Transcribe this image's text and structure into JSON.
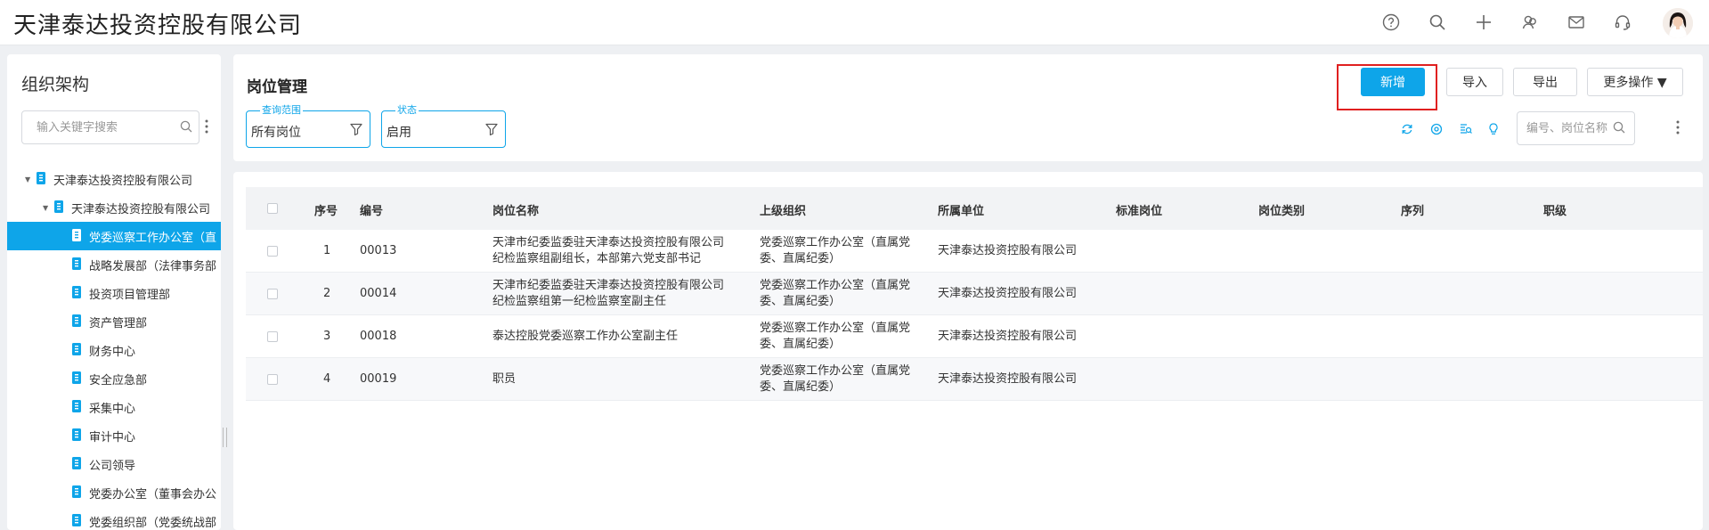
{
  "app": {
    "title": "天津泰达投资控股有限公司"
  },
  "header_icons": [
    "help-icon",
    "search-icon",
    "plus-icon",
    "users-icon",
    "mail-icon",
    "headset-icon"
  ],
  "left": {
    "title": "组织架构",
    "search_placeholder": "输入关键字搜索",
    "tree": [
      {
        "label": "天津泰达投资控股有限公司",
        "level": 0,
        "expanded": true,
        "selected": false
      },
      {
        "label": "天津泰达投资控股有限公司",
        "level": 1,
        "expanded": true,
        "selected": false
      },
      {
        "label": "党委巡察工作办公室（直",
        "level": 2,
        "selected": true
      },
      {
        "label": "战略发展部（法律事务部",
        "level": 2,
        "selected": false
      },
      {
        "label": "投资项目管理部",
        "level": 2,
        "selected": false
      },
      {
        "label": "资产管理部",
        "level": 2,
        "selected": false
      },
      {
        "label": "财务中心",
        "level": 2,
        "selected": false
      },
      {
        "label": "安全应急部",
        "level": 2,
        "selected": false
      },
      {
        "label": "采集中心",
        "level": 2,
        "selected": false
      },
      {
        "label": "审计中心",
        "level": 2,
        "selected": false
      },
      {
        "label": "公司领导",
        "level": 2,
        "selected": false
      },
      {
        "label": "党委办公室（董事会办公",
        "level": 2,
        "selected": false
      },
      {
        "label": "党委组织部（党委统战部",
        "level": 2,
        "selected": false
      }
    ]
  },
  "main": {
    "title": "岗位管理",
    "buttons": {
      "add": "新增",
      "import": "导入",
      "export": "导出",
      "more": "更多操作 ▼"
    },
    "filters": [
      {
        "label": "查询范围",
        "value": "所有岗位"
      },
      {
        "label": "状态",
        "value": "启用"
      }
    ],
    "search_placeholder": "编号、岗位名称"
  },
  "table": {
    "columns": [
      "序号",
      "编号",
      "岗位名称",
      "上级组织",
      "所属单位",
      "标准岗位",
      "岗位类别",
      "序列",
      "职级"
    ],
    "rows": [
      {
        "index": "1",
        "code": "00013",
        "name": [
          "天津市纪委监委驻天津泰达投资控股有限公司",
          "纪检监察组副组长，本部第六党支部书记"
        ],
        "parent": [
          "党委巡察工作办公室（直属党",
          "委、直属纪委）"
        ],
        "unit": "天津泰达投资控股有限公司"
      },
      {
        "index": "2",
        "code": "00014",
        "name": [
          "天津市纪委监委驻天津泰达投资控股有限公司",
          "纪检监察组第一纪检监察室副主任"
        ],
        "parent": [
          "党委巡察工作办公室（直属党",
          "委、直属纪委）"
        ],
        "unit": "天津泰达投资控股有限公司"
      },
      {
        "index": "3",
        "code": "00018",
        "name": [
          "泰达控股党委巡察工作办公室副主任"
        ],
        "parent": [
          "党委巡察工作办公室（直属党",
          "委、直属纪委）"
        ],
        "unit": "天津泰达投资控股有限公司"
      },
      {
        "index": "4",
        "code": "00019",
        "name": [
          "职员"
        ],
        "parent": [
          "党委巡察工作办公室（直属党",
          "委、直属纪委）"
        ],
        "unit": "天津泰达投资控股有限公司"
      }
    ]
  },
  "colors": {
    "primary": "#0ea5e9",
    "highlight_border": "#e02020",
    "background": "#eef0f3"
  }
}
